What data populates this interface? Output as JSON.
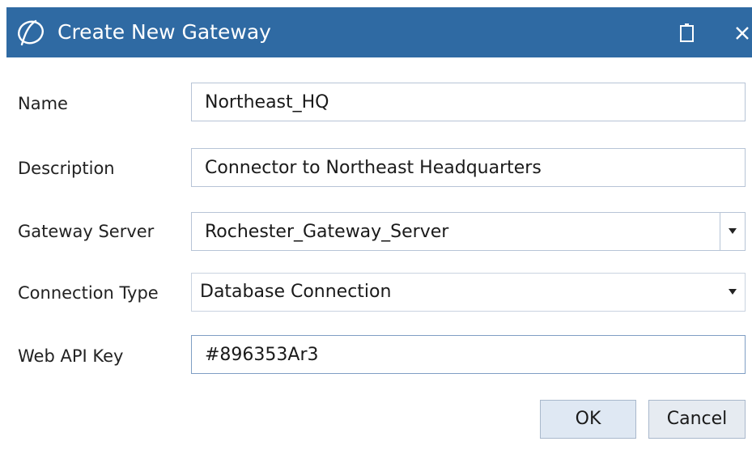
{
  "window": {
    "title": "Create New Gateway",
    "icons": {
      "logo": "app-logo-icon",
      "restore": "restore-icon",
      "close": "close-icon"
    }
  },
  "form": {
    "name": {
      "label": "Name",
      "value": "Northeast_HQ"
    },
    "description": {
      "label": "Description",
      "value": "Connector to Northeast Headquarters"
    },
    "gateway_server": {
      "label": "Gateway Server",
      "value": "Rochester_Gateway_Server"
    },
    "connection_type": {
      "label": "Connection Type",
      "value": "Database Connection"
    },
    "web_api_key": {
      "label": "Web API Key",
      "value": "#896353Ar3"
    }
  },
  "buttons": {
    "ok": "OK",
    "cancel": "Cancel"
  },
  "colors": {
    "titlebar": "#2f6aa3",
    "field_border": "#b7c4d6",
    "button_bg": "#dfe8f3"
  }
}
